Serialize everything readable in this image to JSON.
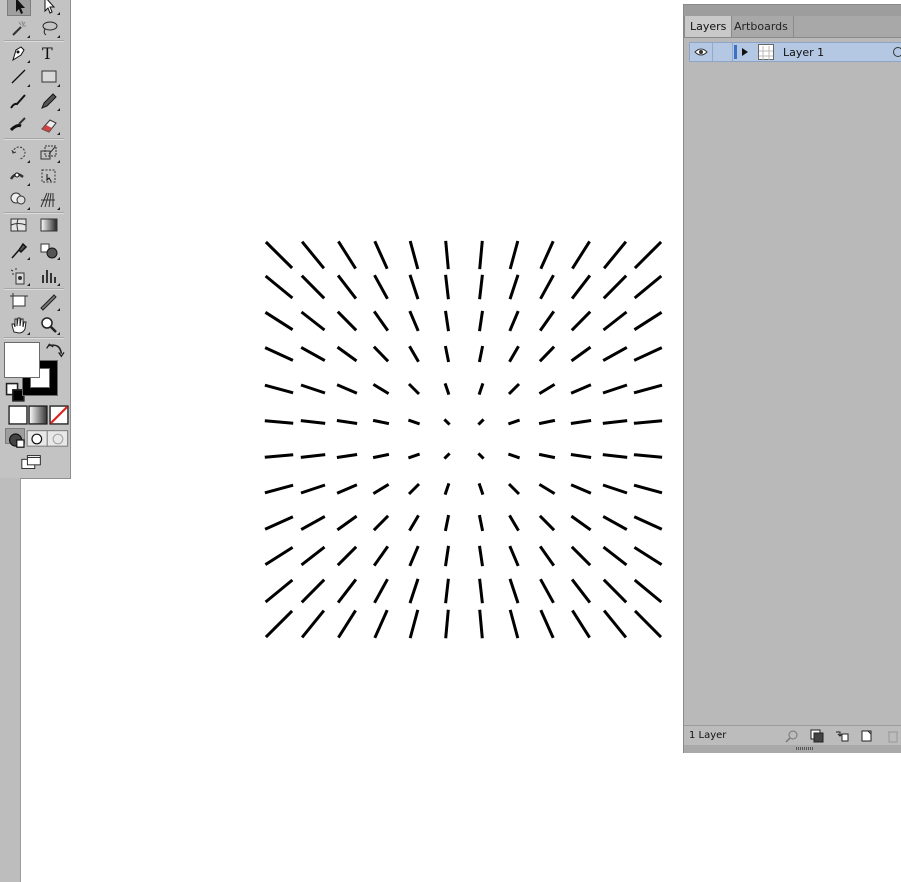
{
  "layers_panel": {
    "tabs": [
      {
        "label": "Layers",
        "active": true
      },
      {
        "label": "Artboards",
        "active": false
      }
    ],
    "layers": [
      {
        "name": "Layer 1",
        "visible": true,
        "selected": true,
        "color": "#3d6fc7"
      }
    ],
    "footer": {
      "layer_count": "1 Layer"
    }
  },
  "toolbar": {
    "tools": [
      "selection-tool",
      "direct-selection-tool",
      "magic-wand-tool",
      "lasso-tool",
      "pen-tool",
      "type-tool",
      "line-segment-tool",
      "rectangle-tool",
      "paintbrush-tool",
      "pencil-tool",
      "blob-brush-tool",
      "eraser-tool",
      "rotate-tool",
      "scale-tool",
      "width-tool",
      "free-transform-tool",
      "shape-builder-tool",
      "perspective-grid-tool",
      "mesh-tool",
      "gradient-tool",
      "eyedropper-tool",
      "blend-tool",
      "symbol-sprayer-tool",
      "column-graph-tool",
      "artboard-tool",
      "slice-tool",
      "hand-tool",
      "zoom-tool"
    ],
    "fill_color": "#ffffff",
    "stroke_color": "#000000"
  },
  "artwork": {
    "description_type": "radial-line-grid",
    "rows": 12,
    "cols": 12,
    "stroke_color": "#000000"
  }
}
